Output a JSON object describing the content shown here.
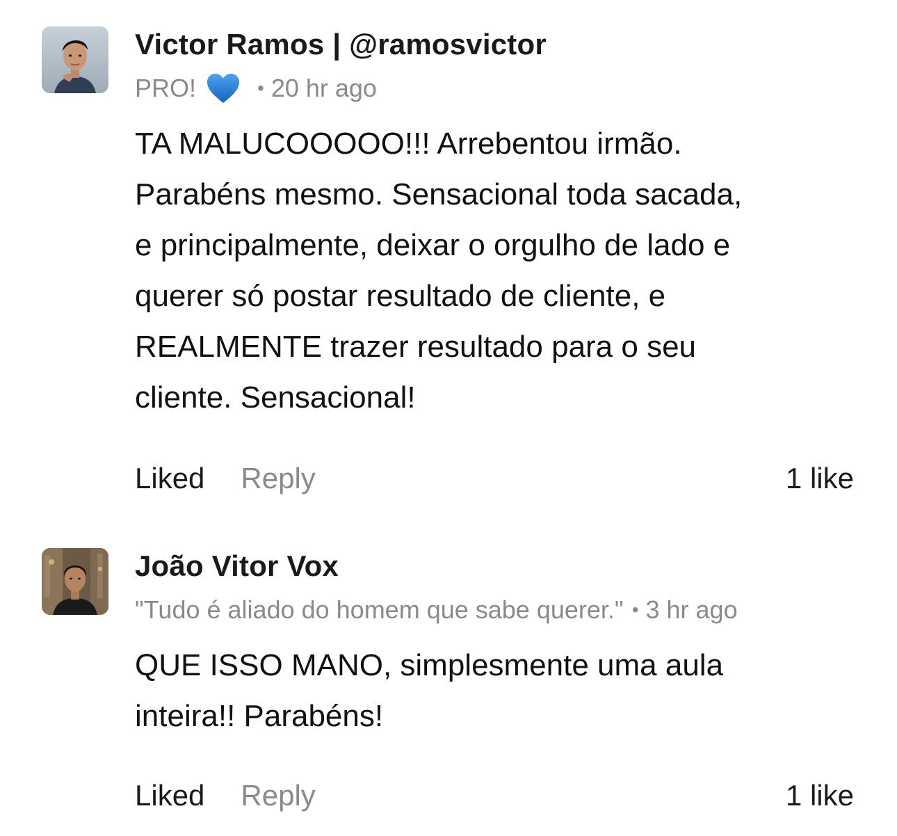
{
  "comments": [
    {
      "author": "Victor Ramos | @ramosvictor",
      "flair": "PRO!",
      "flair_icon": "blue-heart-icon",
      "separator": "•",
      "time": "20 hr ago",
      "body_lines": [
        "TA MALUCOOOOO!!! Arrebentou irmão.",
        "Parabéns mesmo. Sensacional toda sacada,",
        "e principalmente, deixar o orgulho de lado e",
        "querer só postar resultado de cliente, e",
        "REALMENTE trazer resultado para o seu",
        "cliente. Sensacional!"
      ],
      "liked_label": "Liked",
      "reply_label": "Reply",
      "like_count": "1 like"
    },
    {
      "author": "João Vitor Vox",
      "flair": "\"Tudo é aliado do homem que sabe querer.\"",
      "separator": "•",
      "time": "3 hr ago",
      "body_lines": [
        "QUE ISSO MANO, simplesmente uma aula",
        "inteira!! Parabéns!"
      ],
      "liked_label": "Liked",
      "reply_label": "Reply",
      "like_count": "1 like"
    }
  ],
  "colors": {
    "text_primary": "#111111",
    "text_secondary": "#8a8a8e",
    "heart": "#1e88e5"
  }
}
